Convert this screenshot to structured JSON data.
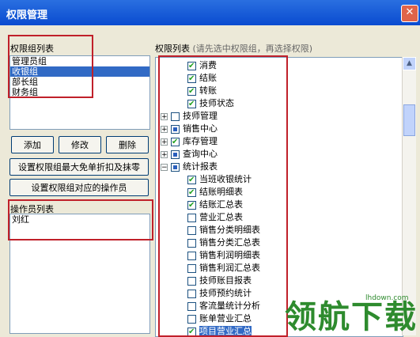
{
  "window": {
    "title": "权限管理",
    "close": "✕"
  },
  "groups": {
    "label": "权限组列表",
    "items": [
      "管理员组",
      "收银组",
      "部长组",
      "财务组"
    ],
    "selected_index": 1
  },
  "buttons": {
    "add": "添加",
    "edit": "修改",
    "delete": "删除",
    "set_max": "设置权限组最大免单折扣及抹零",
    "set_operators": "设置权限组对应的操作员"
  },
  "operators": {
    "label": "操作员列表",
    "items": [
      "刘红"
    ]
  },
  "permissions": {
    "label": "权限列表",
    "hint": "(请先选中权限组，再选择权限)",
    "rows": [
      {
        "text": "消费",
        "level": 1,
        "state": "checked",
        "expander": ""
      },
      {
        "text": "结账",
        "level": 1,
        "state": "checked",
        "expander": ""
      },
      {
        "text": "转账",
        "level": 1,
        "state": "checked",
        "expander": ""
      },
      {
        "text": "技师状态",
        "level": 1,
        "state": "checked",
        "expander": ""
      },
      {
        "text": "技师管理",
        "level": 0,
        "state": "unchecked",
        "expander": "+"
      },
      {
        "text": "销售中心",
        "level": 0,
        "state": "partial",
        "expander": "+"
      },
      {
        "text": "库存管理",
        "level": 0,
        "state": "checked",
        "expander": "+"
      },
      {
        "text": "查询中心",
        "level": 0,
        "state": "partial",
        "expander": "+"
      },
      {
        "text": "统计报表",
        "level": 0,
        "state": "partial",
        "expander": "−"
      },
      {
        "text": "当班收银统计",
        "level": 1,
        "state": "checked",
        "expander": ""
      },
      {
        "text": "结账明细表",
        "level": 1,
        "state": "checked",
        "expander": ""
      },
      {
        "text": "结账汇总表",
        "level": 1,
        "state": "checked",
        "expander": ""
      },
      {
        "text": "营业汇总表",
        "level": 1,
        "state": "unchecked",
        "expander": ""
      },
      {
        "text": "销售分类明细表",
        "level": 1,
        "state": "unchecked",
        "expander": ""
      },
      {
        "text": "销售分类汇总表",
        "level": 1,
        "state": "unchecked",
        "expander": ""
      },
      {
        "text": "销售利润明细表",
        "level": 1,
        "state": "unchecked",
        "expander": ""
      },
      {
        "text": "销售利润汇总表",
        "level": 1,
        "state": "unchecked",
        "expander": ""
      },
      {
        "text": "技师账目报表",
        "level": 1,
        "state": "unchecked",
        "expander": ""
      },
      {
        "text": "技师预约统计",
        "level": 1,
        "state": "unchecked",
        "expander": ""
      },
      {
        "text": "客流量统计分析",
        "level": 1,
        "state": "unchecked",
        "expander": ""
      },
      {
        "text": "账单营业汇总",
        "level": 1,
        "state": "unchecked",
        "expander": ""
      },
      {
        "text": "项目营业汇总",
        "level": 1,
        "state": "checked",
        "expander": "",
        "selected": true
      }
    ]
  },
  "watermark": {
    "text": "领航下载",
    "url": "lhdown.com"
  }
}
